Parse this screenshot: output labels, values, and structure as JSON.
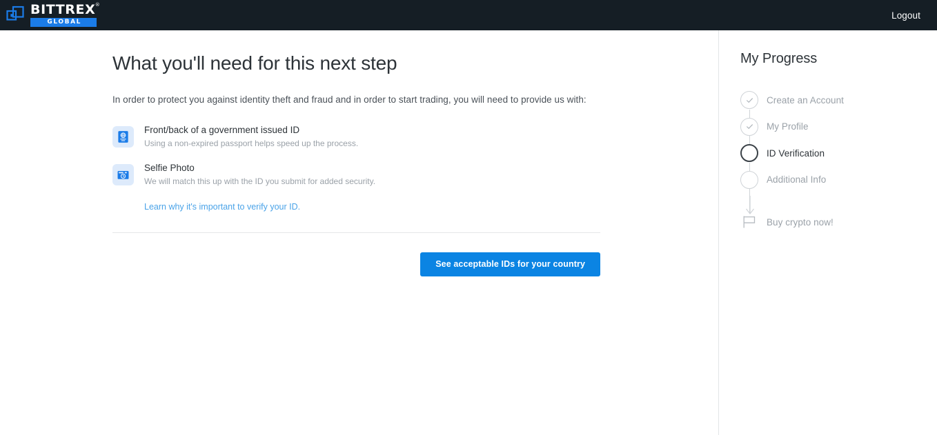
{
  "header": {
    "logo_word": "BITTREX",
    "logo_reg": "®",
    "logo_sub": "GLOBAL",
    "logout_label": "Logout",
    "bg_color": "#151e25",
    "accent_color": "#1b7ce8"
  },
  "main": {
    "title": "What you'll need for this next step",
    "intro": "In order to protect you against identity theft and fraud and in order to start trading, you will need to provide us with:",
    "requirements": [
      {
        "icon": "passport-icon",
        "title": "Front/back of a government issued ID",
        "subtitle": "Using a non-expired passport helps speed up the process."
      },
      {
        "icon": "camera-icon",
        "title": "Selfie Photo",
        "subtitle": "We will match this up with the ID you submit for added security."
      }
    ],
    "learn_link": "Learn why it's important to verify your ID.",
    "cta_label": "See acceptable IDs for your country",
    "cta_color": "#0b84e3",
    "link_color": "#4aa3e8"
  },
  "sidebar": {
    "title": "My Progress",
    "steps": [
      {
        "label": "Create an Account",
        "state": "complete",
        "icon": "check-icon"
      },
      {
        "label": "My Profile",
        "state": "complete",
        "icon": "check-icon"
      },
      {
        "label": "ID Verification",
        "state": "current",
        "icon": "empty-circle-icon"
      },
      {
        "label": "Additional Info",
        "state": "upcoming",
        "icon": "empty-circle-icon"
      }
    ],
    "final_step": {
      "label": "Buy crypto now!",
      "icon": "flag-icon"
    }
  }
}
